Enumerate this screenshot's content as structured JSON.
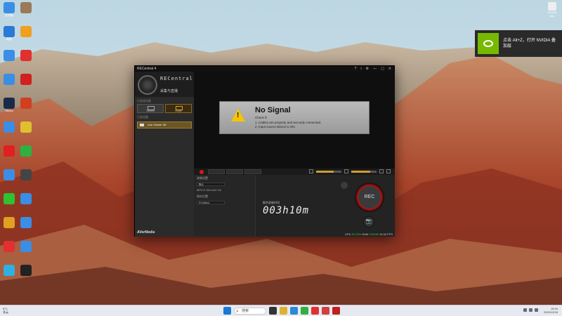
{
  "desktop": {
    "icons": [
      {
        "label": "此电脑",
        "color": "#3a8ee6"
      },
      {
        "label": "",
        "color": "#9a7a5a"
      },
      {
        "label": "网络",
        "color": "#2a7ad6"
      },
      {
        "label": "",
        "color": "#f0a020"
      },
      {
        "label": "",
        "color": "#3a8ee6"
      },
      {
        "label": "",
        "color": "#e03030"
      },
      {
        "label": "",
        "color": "#3a8ee6"
      },
      {
        "label": "",
        "color": "#d02020"
      },
      {
        "label": "Steam",
        "color": "#1a2a4a"
      },
      {
        "label": "",
        "color": "#d04020"
      },
      {
        "label": "",
        "color": "#3a8ee6"
      },
      {
        "label": "",
        "color": "#e0c030"
      },
      {
        "label": "",
        "color": "#e02020"
      },
      {
        "label": "",
        "color": "#30b040"
      },
      {
        "label": "",
        "color": "#3a8ee6"
      },
      {
        "label": "",
        "color": "#444"
      },
      {
        "label": "",
        "color": "#30c030"
      },
      {
        "label": "",
        "color": "#3a8ee6"
      },
      {
        "label": "",
        "color": "#e0a020"
      },
      {
        "label": "",
        "color": "#3a8ee6"
      },
      {
        "label": "",
        "color": "#e03030"
      },
      {
        "label": "",
        "color": "#3a8ee6"
      },
      {
        "label": "",
        "color": "#30b0e0"
      },
      {
        "label": "",
        "color": "#222"
      }
    ],
    "topright_icon_label": "NVIDIA App"
  },
  "notification": {
    "line1": "点击 Alt+Z，打开 NVIDIA 叠",
    "line2": "加层"
  },
  "app": {
    "title": "RECentral 4",
    "window_controls": [
      "?",
      "i",
      "⚙",
      "—",
      "▢",
      "✕"
    ],
    "brand": "RECentral",
    "mode": "采集与直播",
    "device_section": "已连接设备",
    "devices": [
      {
        "label": "Stream"
      },
      {
        "label": "Single"
      }
    ],
    "source_section": "已选设备",
    "selected_device": "Live Gamer 4K",
    "no_signal": {
      "title": "No Signal",
      "check": "Check if:",
      "line1": "1. Cables are properly and securely connected.",
      "line2": "2. Input source device is ON."
    },
    "controls": {
      "settings_label": "录制设置",
      "profile_value": "默认",
      "format_label": "MP4 H.264 AAC 4K",
      "folder_label": "保存位置",
      "folder_value": "D:\\Videos"
    },
    "timer_label": "剩余录制时间",
    "timer_value": "003h10m",
    "rec_label": "REC",
    "camera_icon": "📷",
    "volume_level": 0.7,
    "mic_level": 0.75,
    "status": {
      "cpu_label": "CPU",
      "cpu_value": "32.20%",
      "ram_label": "RAM",
      "ram_value": "9.51GB",
      "time": "15:34",
      "fps": "FPS"
    },
    "footer_logo": "AVerMedia"
  },
  "taskbar": {
    "weather": "8°C",
    "weather_desc": "多云",
    "search_placeholder": "搜索",
    "time": "15:34",
    "date": "2023/12/18"
  }
}
